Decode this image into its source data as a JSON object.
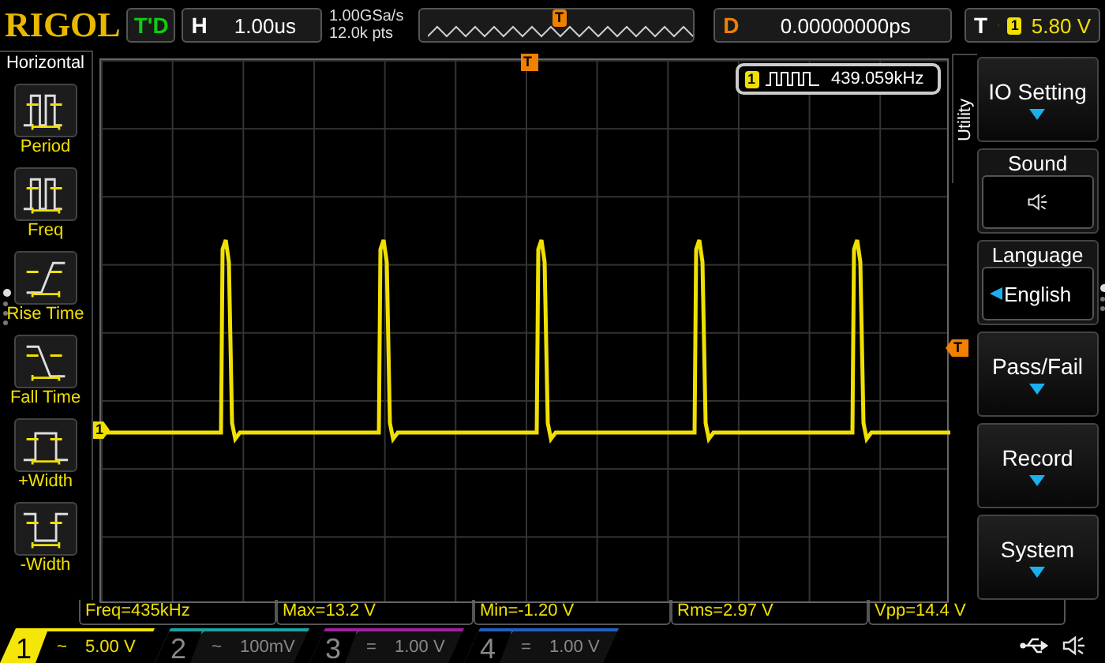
{
  "brand": "RIGOL",
  "run_status": "T'D",
  "horizontal": {
    "label": "H",
    "value": "1.00us"
  },
  "sample": {
    "rate": "1.00GSa/s",
    "points": "12.0k pts"
  },
  "memory_marker": "T",
  "delay": {
    "label": "D",
    "value": "0.00000000ps"
  },
  "trigger": {
    "label": "T",
    "source": "1",
    "level": "5.80 V"
  },
  "left_menu": {
    "title": "Horizontal",
    "pages": [
      {
        "selected": true
      },
      {
        "selected": false
      },
      {
        "selected": false
      },
      {
        "selected": false
      }
    ],
    "items": [
      {
        "label": "Period",
        "kind": "period"
      },
      {
        "label": "Freq",
        "kind": "freq"
      },
      {
        "label": "Rise Time",
        "kind": "rise"
      },
      {
        "label": "Fall Time",
        "kind": "fall"
      },
      {
        "label": "+Width",
        "kind": "pwidth"
      },
      {
        "label": "-Width",
        "kind": "nwidth"
      }
    ]
  },
  "screen": {
    "trigger_position_marker": "T",
    "trigger_level_marker": "T",
    "channel_marker": "1",
    "counter": {
      "channel": "1",
      "value": "439.059kHz"
    }
  },
  "right_menu": {
    "title": "Utility",
    "pages": [
      {
        "selected": true
      },
      {
        "selected": false
      },
      {
        "selected": false
      }
    ],
    "items": [
      {
        "kind": "submenu",
        "label": "IO Setting"
      },
      {
        "kind": "icon",
        "label": "Sound",
        "on": true
      },
      {
        "kind": "value",
        "label": "Language",
        "value": "English"
      },
      {
        "kind": "submenu",
        "label": "Pass/Fail"
      },
      {
        "kind": "submenu",
        "label": "Record"
      },
      {
        "kind": "submenu",
        "label": "System"
      }
    ]
  },
  "measurements": [
    "Freq=435kHz",
    "Max=13.2 V",
    "Min=-1.20 V",
    "Rms=2.97 V",
    "Vpp=14.4 V"
  ],
  "channels": [
    {
      "number": "1",
      "coupling": "~",
      "scale": "5.00 V",
      "active": true,
      "color": "#f5e60a"
    },
    {
      "number": "2",
      "coupling": "~",
      "scale": "100mV",
      "active": false,
      "color": "#20a0a0"
    },
    {
      "number": "3",
      "coupling": "=",
      "scale": "1.00 V",
      "active": false,
      "color": "#a020a0"
    },
    {
      "number": "4",
      "coupling": "=",
      "scale": "1.00 V",
      "active": false,
      "color": "#2060c0"
    }
  ]
}
